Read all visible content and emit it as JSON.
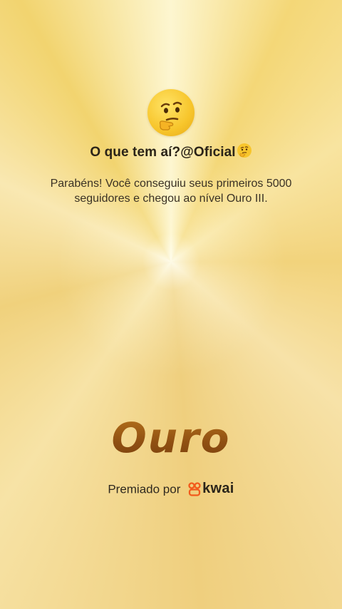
{
  "profile": {
    "avatar_icon": "thinking-face-icon",
    "title": "O que tem aí?@Oficial",
    "title_emoji_icon": "thinking-face-icon"
  },
  "message": {
    "line1": "Parabéns! Você conseguiu seus primeiros 5000",
    "line2": "seguidores e chegou ao nível Ouro III."
  },
  "badge": {
    "level_name": "Ouro"
  },
  "footer": {
    "awarded_by": "Premiado por",
    "brand_name": "kwai",
    "brand_icon": "kwai-logo-icon",
    "brand_color": "#f25a1c"
  },
  "colors": {
    "background_gold": "#f4d777",
    "brand_text_brown": "#8f4f12"
  }
}
